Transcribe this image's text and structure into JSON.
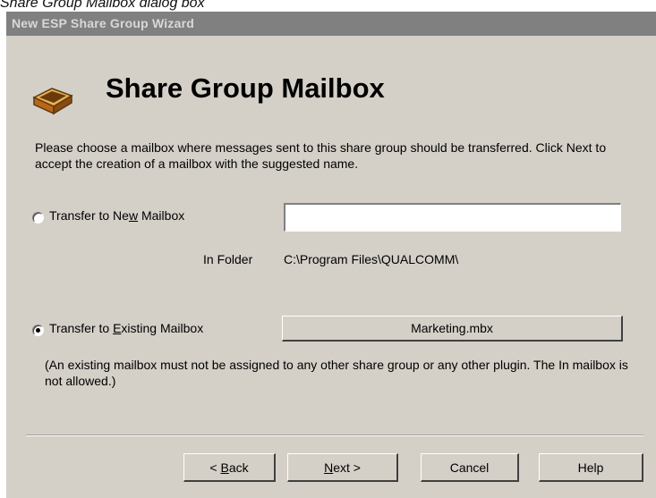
{
  "caption": "Share Group Mailbox dialog box",
  "window": {
    "title": "New ESP Share Group Wizard"
  },
  "page": {
    "title": "Share Group Mailbox"
  },
  "description": "Please choose a mailbox where messages sent to this share group should be transferred. Click Next to accept the creation of a mailbox with the suggested name.",
  "options": {
    "new_mailbox": {
      "label_pre": "Transfer to Ne",
      "label_key": "w",
      "label_post": " Mailbox",
      "selected": false,
      "input_value": "",
      "folder_label": "In Folder",
      "folder_path": "C:\\Program Files\\QUALCOMM\\"
    },
    "existing_mailbox": {
      "label_pre": "Transfer to ",
      "label_key": "E",
      "label_post": "xisting Mailbox",
      "selected": true,
      "button_label": "Marketing.mbx",
      "note": "(An existing mailbox must not be assigned to any other share group or any other plugin. The In mailbox is not allowed.)"
    }
  },
  "buttons": {
    "back": {
      "pre": "< ",
      "key": "B",
      "post": "ack"
    },
    "next": {
      "pre": "",
      "key": "N",
      "post": "ext >"
    },
    "cancel": "Cancel",
    "help": "Help"
  },
  "icons": {
    "mailbox": "mailbox-tray-icon"
  }
}
